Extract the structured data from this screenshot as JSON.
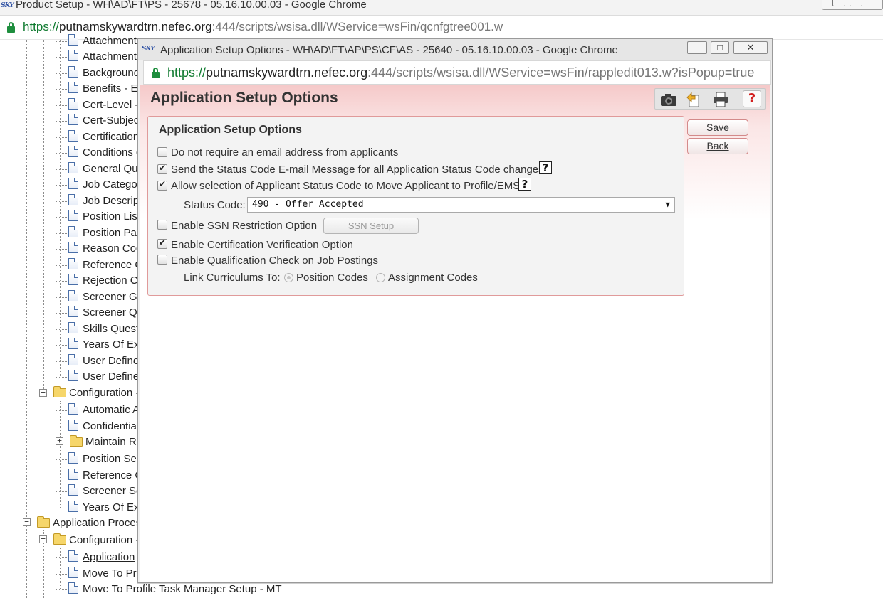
{
  "back_window": {
    "title": "Product Setup - WH\\AD\\FT\\PS - 25678 - 05.16.10.00.03 - Google Chrome",
    "url_scheme": "https://",
    "url_host": "putnamskywardtrn.nefec.org",
    "url_path": ":444/scripts/wsisa.dll/WService=wsFin/qcnfgtree001.w",
    "tree": {
      "items": [
        {
          "label": "Attachment"
        },
        {
          "label": "Attachment"
        },
        {
          "label": "Background"
        },
        {
          "label": "Benefits - E"
        },
        {
          "label": "Cert-Level -"
        },
        {
          "label": "Cert-Subjec"
        },
        {
          "label": "Certification"
        },
        {
          "label": "Conditions c"
        },
        {
          "label": "General Qu"
        },
        {
          "label": "Job Categor"
        },
        {
          "label": "Job Descrip"
        },
        {
          "label": "Position List"
        },
        {
          "label": "Position Pay"
        },
        {
          "label": "Reason Cod"
        },
        {
          "label": "Reference C"
        },
        {
          "label": "Rejection C"
        },
        {
          "label": "Screener Gr"
        },
        {
          "label": "Screener Qu"
        },
        {
          "label": "Skills Quest"
        },
        {
          "label": "Years Of Ex"
        },
        {
          "label": "User Define"
        },
        {
          "label": "User Define"
        }
      ],
      "config_folder": "Configuration -",
      "config_items": [
        {
          "label": "Automatic A"
        },
        {
          "label": "Confidential"
        }
      ],
      "maintain_folder": "Maintain Re",
      "config_items_2": [
        {
          "label": "Position Set"
        },
        {
          "label": "Reference C"
        },
        {
          "label": "Screener Se"
        },
        {
          "label": "Years Of Ex"
        }
      ],
      "app_process_folder": "Application Proces",
      "app_config_folder": "Configuration -",
      "app_items": [
        {
          "label": "Application"
        },
        {
          "label": "Move To Pr"
        },
        {
          "label": "Move To Profile Task Manager Setup - MT"
        }
      ]
    }
  },
  "popup": {
    "title": "Application Setup Options - WH\\AD\\FT\\AP\\PS\\CF\\AS - 25640 - 05.16.10.00.03 - Google Chrome",
    "url_scheme": "https://",
    "url_host": "putnamskywardtrn.nefec.org",
    "url_path": ":444/scripts/wsisa.dll/WService=wsFin/rappledit013.w?isPopup=true",
    "page_title": "Application Setup Options",
    "panel_title": "Application Setup Options",
    "options": {
      "no_email": {
        "label": "Do not require an email address from applicants",
        "checked": false
      },
      "send_status_email": {
        "label": "Send the Status Code E-mail Message for all Application Status Code changes",
        "checked": true
      },
      "allow_status_move": {
        "label": "Allow selection of Applicant Status Code to Move Applicant to Profile/EMS",
        "checked": true
      },
      "enable_ssn": {
        "label": "Enable SSN Restriction Option",
        "checked": false
      },
      "enable_cert": {
        "label": "Enable Certification Verification Option",
        "checked": true
      },
      "enable_qual": {
        "label": "Enable Qualification Check on Job Postings",
        "checked": false
      }
    },
    "status_code": {
      "label": "Status Code:",
      "value": "490 - Offer Accepted"
    },
    "ssn_setup_button": "SSN Setup",
    "link_curriculums": {
      "label": "Link Curriculums To:",
      "position_codes": "Position Codes",
      "assignment_codes": "Assignment Codes",
      "selected": "Position Codes"
    },
    "help_marker": "?",
    "save_button": "Save",
    "back_button": "Back",
    "colors": {
      "header_gradient": "#f5c9c9",
      "panel_border": "#e09a9a",
      "help_red": "#d21f1f",
      "secure_green": "#0f7a2f"
    }
  }
}
